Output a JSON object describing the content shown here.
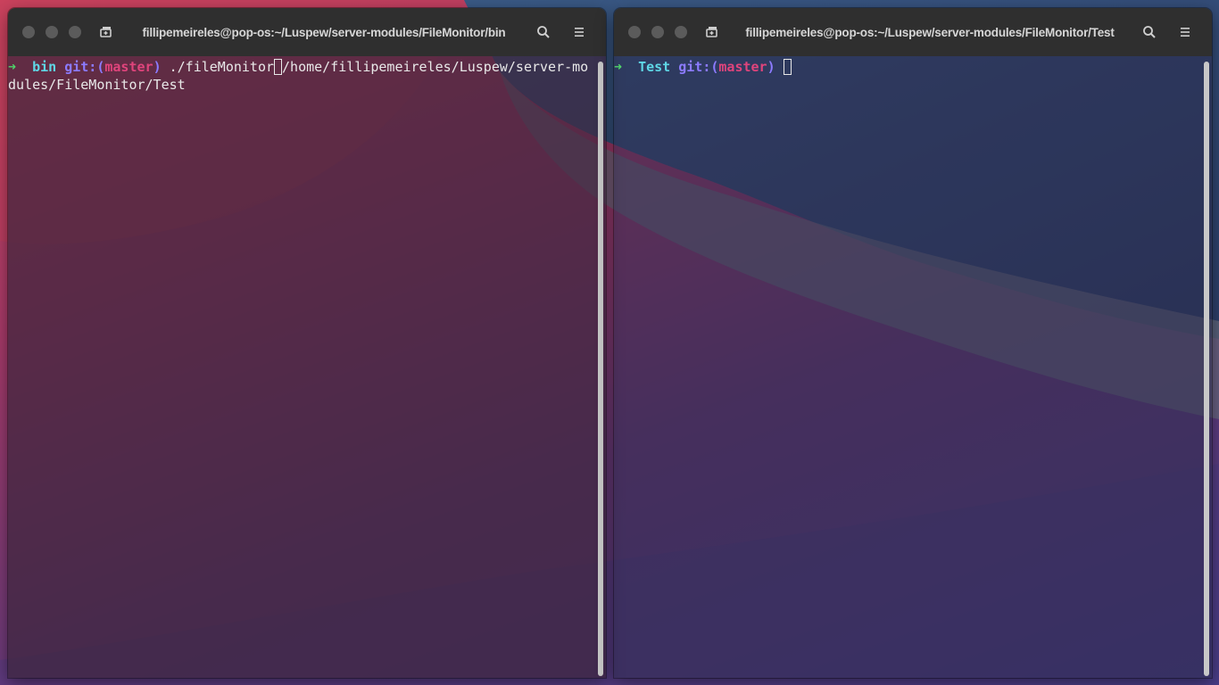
{
  "left_terminal": {
    "title": "fillipemeireles@pop-os:~/Luspew/server-modules/FileMonitor/bin",
    "prompt_arrow": "➜",
    "dir": "bin",
    "git_label": "git:(",
    "branch": "master",
    "git_close": ")",
    "command": "./fileMonitor",
    "argument": "/home/fillipemeireles/Luspew/server-modules/FileMonitor/Test"
  },
  "right_terminal": {
    "title": "fillipemeireles@pop-os:~/Luspew/server-modules/FileMonitor/Test",
    "prompt_arrow": "➜",
    "dir": "Test",
    "git_label": "git:(",
    "branch": "master",
    "git_close": ")"
  },
  "icons": {
    "new_tab": "new-tab-icon",
    "search": "search-icon",
    "menu": "hamburger-menu-icon"
  },
  "colors": {
    "titlebar": "#2f2f2f",
    "prompt_arrow": "#4fd36a",
    "dir": "#5fd7e6",
    "git": "#8c7bff",
    "branch": "#e0447c"
  }
}
